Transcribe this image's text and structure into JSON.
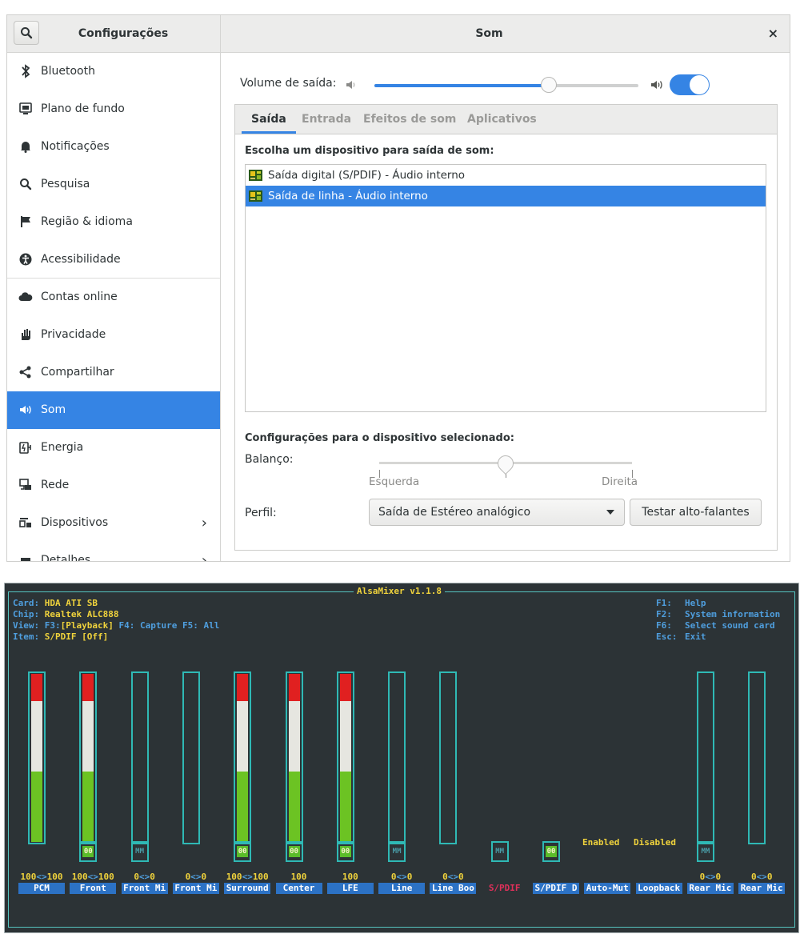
{
  "settings": {
    "app_title": "Configurações",
    "panel_title": "Som",
    "close_glyph": "×",
    "accent_color": "#3584e4",
    "sidebar": [
      {
        "label": "Bluetooth",
        "icon": "bluetooth-icon",
        "sep": false,
        "active": false,
        "chevron": false
      },
      {
        "label": "Plano de fundo",
        "icon": "background-icon",
        "sep": false,
        "active": false,
        "chevron": false
      },
      {
        "label": "Notificações",
        "icon": "bell-icon",
        "sep": false,
        "active": false,
        "chevron": false
      },
      {
        "label": "Pesquisa",
        "icon": "search-icon",
        "sep": false,
        "active": false,
        "chevron": false
      },
      {
        "label": "Região & idioma",
        "icon": "flag-icon",
        "sep": false,
        "active": false,
        "chevron": false
      },
      {
        "label": "Acessibilidade",
        "icon": "accessibility-icon",
        "sep": true,
        "active": false,
        "chevron": false
      },
      {
        "label": "Contas online",
        "icon": "cloud-icon",
        "sep": false,
        "active": false,
        "chevron": false
      },
      {
        "label": "Privacidade",
        "icon": "hand-icon",
        "sep": false,
        "active": false,
        "chevron": false
      },
      {
        "label": "Compartilhar",
        "icon": "share-icon",
        "sep": false,
        "active": false,
        "chevron": false
      },
      {
        "label": "Som",
        "icon": "speaker-icon",
        "sep": false,
        "active": true,
        "chevron": false
      },
      {
        "label": "Energia",
        "icon": "power-icon",
        "sep": false,
        "active": false,
        "chevron": false
      },
      {
        "label": "Rede",
        "icon": "network-icon",
        "sep": false,
        "active": false,
        "chevron": false
      },
      {
        "label": "Dispositivos",
        "icon": "devices-icon",
        "sep": false,
        "active": false,
        "chevron": true
      },
      {
        "label": "Detalhes",
        "icon": "details-icon",
        "sep": false,
        "active": false,
        "chevron": true
      }
    ],
    "volume": {
      "label": "Volume de saída:",
      "level": 0.66,
      "enabled": true
    },
    "tabs": [
      {
        "label": "Saída",
        "active": true
      },
      {
        "label": "Entrada",
        "active": false
      },
      {
        "label": "Efeitos de som",
        "active": false
      },
      {
        "label": "Aplicativos",
        "active": false
      }
    ],
    "output": {
      "choose_title": "Escolha um dispositivo para saída de som:",
      "devices": [
        {
          "label": "Saída digital (S/PDIF) - Áudio interno",
          "selected": false
        },
        {
          "label": "Saída de linha - Áudio interno",
          "selected": true
        }
      ],
      "config_title": "Configurações para o dispositivo selecionado:",
      "balance_label": "Balanço:",
      "balance_left": "Esquerda",
      "balance_right": "Direita",
      "balance": 0.5,
      "profile_label": "Perfil:",
      "profile_value": "Saída de Estéreo analógico",
      "test_button": "Testar alto-falantes"
    }
  },
  "alsamixer": {
    "title": "AlsaMixer v1.1.8",
    "card_key": "Card:",
    "card": "HDA ATI SB",
    "chip_key": "Chip:",
    "chip": "Realtek ALC888",
    "view_key": "View:",
    "view_f3_key": "F3:",
    "view_f3": "[Playback]",
    "view_f4": "F4: Capture",
    "view_f5": "F5: All",
    "item_key": "Item:",
    "item": "S/PDIF [Off]",
    "help": [
      {
        "key": "F1:",
        "text": "Help"
      },
      {
        "key": "F2:",
        "text": "System information"
      },
      {
        "key": "F6:",
        "text": "Select sound card"
      },
      {
        "key": "Esc:",
        "text": "Exit"
      }
    ],
    "enabled_label": "Enabled",
    "disabled_label": "Disabled",
    "channels": [
      {
        "name": "PCM",
        "bar": true,
        "level": 100,
        "mute": "none",
        "values": [
          "100",
          "100"
        ]
      },
      {
        "name": "Front",
        "bar": true,
        "level": 100,
        "mute": "on",
        "values": [
          "100",
          "100"
        ]
      },
      {
        "name": "Front Mi",
        "bar": true,
        "level": 0,
        "mute": "off",
        "values": [
          "0",
          "0"
        ]
      },
      {
        "name": "Front Mi",
        "bar": true,
        "level": 0,
        "mute": "none",
        "values": [
          "0",
          "0"
        ]
      },
      {
        "name": "Surround",
        "bar": true,
        "level": 100,
        "mute": "on",
        "values": [
          "100",
          "100"
        ]
      },
      {
        "name": "Center",
        "bar": true,
        "level": 100,
        "mute": "on",
        "values": [
          "100"
        ]
      },
      {
        "name": "LFE",
        "bar": true,
        "level": 100,
        "mute": "on",
        "values": [
          "100"
        ]
      },
      {
        "name": "Line",
        "bar": true,
        "level": 0,
        "mute": "off",
        "values": [
          "0",
          "0"
        ]
      },
      {
        "name": "Line Boo",
        "bar": true,
        "level": 0,
        "mute": "none",
        "values": [
          "0",
          "0"
        ]
      },
      {
        "name": "S/PDIF",
        "bar": false,
        "level": 0,
        "mute": "off",
        "values": [],
        "current": true
      },
      {
        "name": "S/PDIF D",
        "bar": false,
        "level": 0,
        "mute": "on",
        "values": []
      },
      {
        "name": "Auto-Mut",
        "bar": false,
        "level": 0,
        "mute": "none",
        "values": []
      },
      {
        "name": "Loopback",
        "bar": false,
        "level": 0,
        "mute": "none",
        "values": []
      },
      {
        "name": "Rear Mic",
        "bar": true,
        "level": 0,
        "mute": "off",
        "values": [
          "0",
          "0"
        ]
      },
      {
        "name": "Rear Mic",
        "bar": true,
        "level": 0,
        "mute": "none",
        "values": [
          "0",
          "0"
        ]
      }
    ],
    "mute_on_text": "00",
    "mute_off_text": "MM",
    "colors": {
      "bg": "#2c3336",
      "frame": "#2fb9b5",
      "label": "#4f9fdf",
      "value": "#f0d33c",
      "red": "#e02020",
      "white": "#e6e6e0",
      "green": "#6cc323",
      "name_bg": "#2c72c5",
      "current": "#e0305a"
    }
  }
}
